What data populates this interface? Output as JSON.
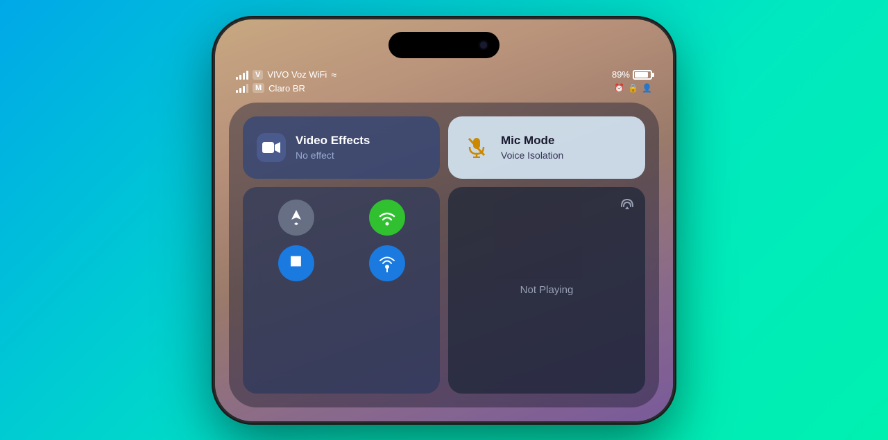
{
  "background": {
    "gradient_start": "#00a8e8",
    "gradient_end": "#00f0b0"
  },
  "status_bar": {
    "row1": {
      "carrier1_badge": "V",
      "carrier1_name": "VIVO Voz WiFi",
      "wifi_symbol": "WiFi",
      "battery_percent": "89%"
    },
    "row2": {
      "carrier2_badge": "M",
      "carrier2_name": "Claro BR",
      "icons": [
        "alarm",
        "lock",
        "portrait"
      ]
    }
  },
  "control_center": {
    "video_effects": {
      "title": "Video Effects",
      "subtitle": "No effect",
      "icon": "🎥"
    },
    "mic_mode": {
      "title": "Mic Mode",
      "subtitle": "Voice Isolation",
      "icon": "🎙"
    },
    "network": {
      "airplane": {
        "icon": "✈",
        "label": ""
      },
      "wifi": {
        "icon": "((·))",
        "label": ""
      },
      "bluetooth": {
        "icon": "B",
        "label": ""
      },
      "cellular": {
        "icon": "📶",
        "label": ""
      }
    },
    "now_playing": {
      "label": "Not Playing",
      "airplay_icon": "⊙"
    }
  },
  "phone": {
    "dynamic_island": true
  }
}
